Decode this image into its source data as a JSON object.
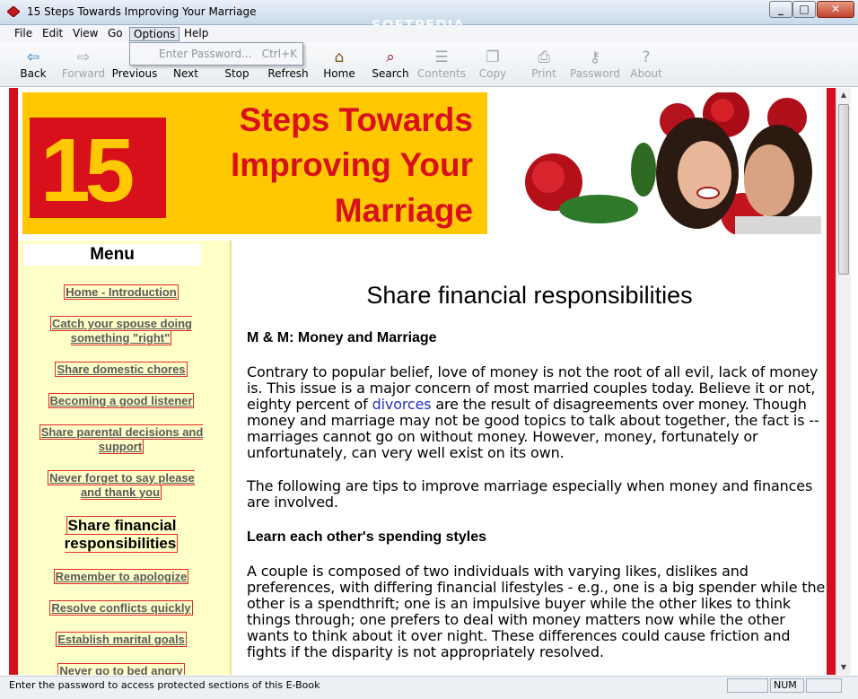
{
  "window": {
    "title": "15 Steps Towards Improving Your Marriage",
    "watermark": "SOFTPEDIA",
    "controls": {
      "minimize": "_",
      "maximize": "□",
      "close": "✕"
    }
  },
  "menubar": {
    "items": [
      "File",
      "Edit",
      "View",
      "Go",
      "Options",
      "Help"
    ],
    "active": "Options"
  },
  "dropdown": {
    "item_label": "Enter Password...",
    "item_shortcut": "Ctrl+K"
  },
  "toolbar": {
    "buttons": [
      {
        "label": "Back",
        "icon": "back-arrow-icon",
        "glyph": "⇦",
        "enabled": true
      },
      {
        "label": "Forward",
        "icon": "forward-arrow-icon",
        "glyph": "⇨",
        "enabled": false
      },
      {
        "label": "Previous",
        "icon": "previous-page-icon",
        "glyph": "",
        "enabled": true
      },
      {
        "label": "Next",
        "icon": "next-page-icon",
        "glyph": "",
        "enabled": true
      },
      {
        "label": "Stop",
        "icon": "stop-icon",
        "glyph": "",
        "enabled": true
      },
      {
        "label": "Refresh",
        "icon": "refresh-icon",
        "glyph": "",
        "enabled": true
      },
      {
        "label": "Home",
        "icon": "home-icon",
        "glyph": "⌂",
        "enabled": true
      },
      {
        "label": "Search",
        "icon": "search-icon",
        "glyph": "⌕",
        "enabled": true
      },
      {
        "label": "Contents",
        "icon": "contents-icon",
        "glyph": "☰",
        "enabled": false
      },
      {
        "label": "Copy",
        "icon": "copy-icon",
        "glyph": "❐",
        "enabled": false
      },
      {
        "label": "Print",
        "icon": "print-icon",
        "glyph": "⎙",
        "enabled": false
      },
      {
        "label": "Password",
        "icon": "key-icon",
        "glyph": "⚷",
        "enabled": false
      },
      {
        "label": "About",
        "icon": "help-icon",
        "glyph": "?",
        "enabled": false
      }
    ]
  },
  "banner": {
    "number": "15",
    "lines": [
      "Steps Towards",
      "Improving Your",
      "Marriage"
    ],
    "colors": {
      "background": "#ffc800",
      "red": "#d8101b"
    }
  },
  "sidebar": {
    "heading": "Menu",
    "links": [
      {
        "label": "Home - Introduction",
        "current": false
      },
      {
        "label": "Catch your spouse doing something \"right\"",
        "current": false
      },
      {
        "label": "Share domestic chores",
        "current": false
      },
      {
        "label": "Becoming a good listener",
        "current": false
      },
      {
        "label": "Share parental decisions and support",
        "current": false
      },
      {
        "label": "Never forget to say please and thank you",
        "current": false
      },
      {
        "label": "Share financial responsibilities",
        "current": true
      },
      {
        "label": "Remember to apologize",
        "current": false
      },
      {
        "label": "Resolve conflicts quickly",
        "current": false
      },
      {
        "label": "Establish marital goals",
        "current": false
      },
      {
        "label": "Never go to bed angry",
        "current": false
      }
    ]
  },
  "article": {
    "title": "Share financial responsibilities",
    "section1_heading": "M & M: Money and Marriage",
    "para1_before_link": "Contrary to popular belief, love of money is not the root of all evil, lack of money is. This issue is a major concern of most married couples today. Believe it or not, eighty percent of ",
    "para1_link": "divorces",
    "para1_after_link": " are the result of disagreements over money. Though money and marriage may not be good topics to talk about together, the fact is -- marriages cannot go on without money. However, money, fortunately or unfortunately, can very well exist on its own.",
    "para2": "The following are tips to improve marriage especially when money and finances are involved.",
    "section2_heading": "Learn each other's spending styles",
    "para3": "A couple is composed of two individuals with varying likes, dislikes and preferences, with differing financial lifestyles - e.g., one is a big spender while the other is a spendthrift; one is an impulsive buyer while the other likes to think things through; one prefers to deal with money matters now while the other wants to think about it over night. These differences could cause friction and fights if the disparity is not appropriately resolved."
  },
  "statusbar": {
    "message": "Enter the password to access protected sections of this E-Book",
    "num": "NUM"
  }
}
